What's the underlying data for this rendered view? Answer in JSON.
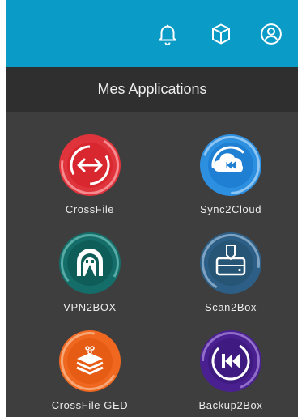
{
  "header": {
    "title": "Mes Applications"
  },
  "toolbar": {
    "icons": [
      "bell-icon",
      "cube-icon",
      "user-icon"
    ]
  },
  "apps": [
    {
      "label": "CrossFile",
      "icon": "arrows-left-right-icon",
      "color": "#e0343c"
    },
    {
      "label": "Sync2Cloud",
      "icon": "cloud-rewind-icon",
      "color": "#2d8fe0"
    },
    {
      "label": "VPN2BOX",
      "icon": "tunnel-icon",
      "color": "#156d69"
    },
    {
      "label": "Scan2Box",
      "icon": "scanner-icon",
      "color": "#2d5f86"
    },
    {
      "label": "CrossFile GED",
      "icon": "document-stack-icon",
      "color": "#f06820"
    },
    {
      "label": "Backup2Box",
      "icon": "rewind-icon",
      "color": "#4a2091"
    }
  ],
  "colors": {
    "topbar": "#0a9bc7",
    "header": "#2f2f2f",
    "panel": "#3e3e3e"
  }
}
